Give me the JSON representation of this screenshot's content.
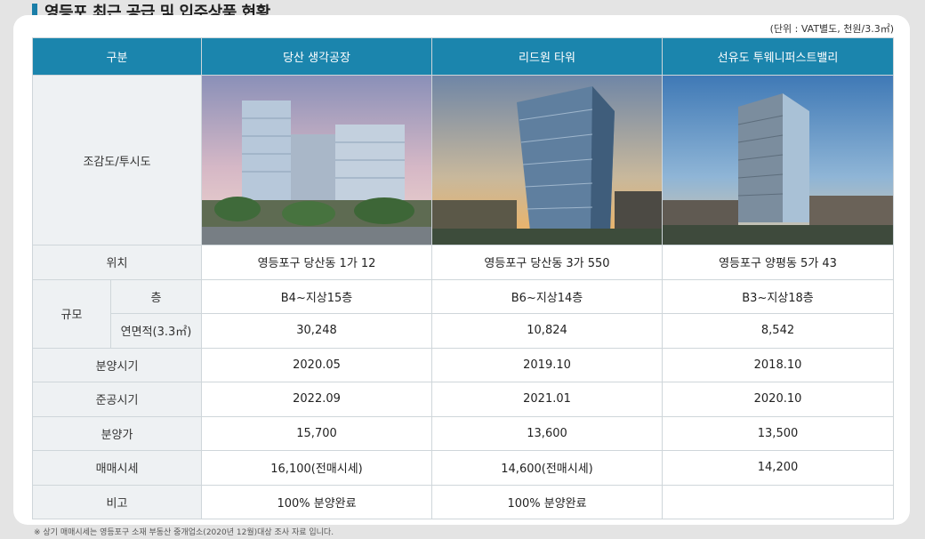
{
  "title": "영등포 최근 공급 및 입주상품 현황",
  "unit_note": "(단위 : VAT별도, 천원/3.3㎡)",
  "header": {
    "category": "구분",
    "col1": "당산 생각공장",
    "col2": "리드원 타워",
    "col3": "선유도 투웨니퍼스트밸리"
  },
  "rows": {
    "image": {
      "label": "조감도/투시도"
    },
    "location": {
      "label": "위치",
      "v1": "영등포구 당산동 1가 12",
      "v2": "영등포구 당산동 3가 550",
      "v3": "영등포구 양평동 5가 43"
    },
    "scale": {
      "label": "규모"
    },
    "floors": {
      "label": "층",
      "v1": "B4~지상15층",
      "v2": "B6~지상14층",
      "v3": "B3~지상18층"
    },
    "area": {
      "label": "연면적(3.3㎡)",
      "v1": "30,248",
      "v2": "10,824",
      "v3": "8,542"
    },
    "sale_period": {
      "label": "분양시기",
      "v1": "2020.05",
      "v2": "2019.10",
      "v3": "2018.10"
    },
    "completion": {
      "label": "준공시기",
      "v1": "2022.09",
      "v2": "2021.01",
      "v3": "2020.10"
    },
    "sale_price": {
      "label": "분양가",
      "v1": "15,700",
      "v2": "13,600",
      "v3": "13,500"
    },
    "market_price": {
      "label": "매매시세",
      "v1": "16,100(전매시세)",
      "v2": "14,600(전매시세)",
      "v3": "14,200"
    },
    "remarks": {
      "label": "비고",
      "v1": "100% 분양완료",
      "v2": "100% 분양완료",
      "v3": ""
    }
  },
  "footnote": "※ 상기 매매시세는 영등포구 소재 부동산 중개업소(2020년 12월)대상 조사 자료 입니다."
}
